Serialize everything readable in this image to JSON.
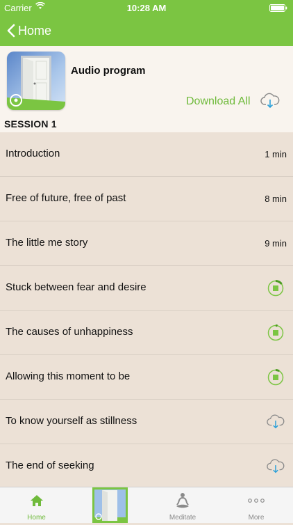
{
  "status_bar": {
    "carrier": "Carrier",
    "time": "10:28 AM"
  },
  "nav": {
    "back_label": "Home"
  },
  "program": {
    "title": "Audio program",
    "download_all_label": "Download All"
  },
  "session": {
    "label": "SESSION 1"
  },
  "tracks": [
    {
      "title": "Introduction",
      "duration": "1 min",
      "state": "duration"
    },
    {
      "title": "Free of future, free of past",
      "duration": "8 min",
      "state": "duration"
    },
    {
      "title": "The little me story",
      "duration": "9 min",
      "state": "duration"
    },
    {
      "title": "Stuck between fear and desire",
      "state": "downloading",
      "progress": 0.15
    },
    {
      "title": "The causes of unhappiness",
      "state": "downloading",
      "progress": 0.04
    },
    {
      "title": "Allowing this moment to be",
      "state": "downloading",
      "progress": 0.08
    },
    {
      "title": "To know yourself as stillness",
      "state": "download"
    },
    {
      "title": "The end of seeking",
      "state": "download"
    }
  ],
  "tab_bar": {
    "items": [
      {
        "label": "Home",
        "icon": "home-icon",
        "active": true
      },
      {
        "label": "",
        "icon": "program-thumbnail",
        "active": false
      },
      {
        "label": "Meditate",
        "icon": "meditate-icon",
        "active": false
      },
      {
        "label": "More",
        "icon": "more-icon",
        "active": false
      }
    ]
  },
  "colors": {
    "accent": "#7bc542",
    "link": "#6fba3b",
    "download_arrow": "#2a9fd8",
    "background": "#ece1d6",
    "header_bg": "#f9f4ee"
  }
}
